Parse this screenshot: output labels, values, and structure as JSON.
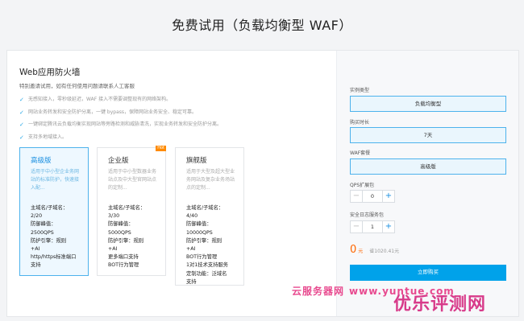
{
  "page_title": "免费试用（负载均衡型 WAF）",
  "product": {
    "title": "Web应用防火墙",
    "subtitle": "特别邀请试用，如有任何使用问题请联系人工客服",
    "features": [
      "无感知接入，零秒级延迟，WAF 接入不需要调整现有的网络架构。",
      "网站业务转发和安全防护分离，一键 bypass，保障网站业务安全、稳定可靠。",
      "一键绑定腾讯云负载均衡实现网站等旁路检测和威胁清洗，实现业务转发和安全防护分离。",
      "支持多地域接入。"
    ]
  },
  "plans": [
    {
      "name": "高级版",
      "desc": "适用于中小型企业务网站的标准防护，快速接入配...",
      "specs": [
        "主域名/子域名：",
        "2/20",
        "防御峰值：",
        "2500QPS",
        "防护引擎：规则",
        "+AI",
        "http/https标准端口",
        "支持"
      ],
      "hot": ""
    },
    {
      "name": "企业版",
      "desc": "适用于中小型数器业务站点及中大型官网站点的定制...",
      "specs": [
        "主域名/子域名：",
        "3/30",
        "防御峰值：",
        "5000QPS",
        "防护引擎：规则",
        "+AI",
        "更多端口支持",
        "BOT行为管理"
      ],
      "hot": "Hot"
    },
    {
      "name": "旗舰版",
      "desc": "适用于大型及超大型业务网站及复杂业务场站点的定制...",
      "specs": [
        "主域名/子域名：",
        "4/40",
        "防御峰值：",
        "10000QPS",
        "防护引擎：规则",
        "+AI",
        "BOT行为管理",
        "1对1技术支持服务",
        "定制功能：泛域名",
        "支持"
      ],
      "hot": ""
    }
  ],
  "order": {
    "instance_type_label": "实例类型",
    "instance_type_value": "负载均衡型",
    "duration_label": "购买时长",
    "duration_value": "7天",
    "package_label": "WAF套餐",
    "package_value": "高级版",
    "qps_label": "QPS扩展包",
    "qps_value": "0",
    "log_label": "安全日志服务包",
    "log_value": "1",
    "minus": "−",
    "plus": "+",
    "price": "0",
    "price_unit": "元",
    "saved": "省1020.41元",
    "buy_label": "立即购买"
  },
  "watermark": {
    "text1": "云服务器网",
    "url": "www.yuntue.com",
    "text2": "优乐评测网"
  },
  "colors": {
    "accent": "#00a2ea",
    "selected_border": "#4db2ec",
    "price": "#ff6600",
    "hot_badge": "#ff8a00",
    "watermark": "#d83b8a"
  }
}
